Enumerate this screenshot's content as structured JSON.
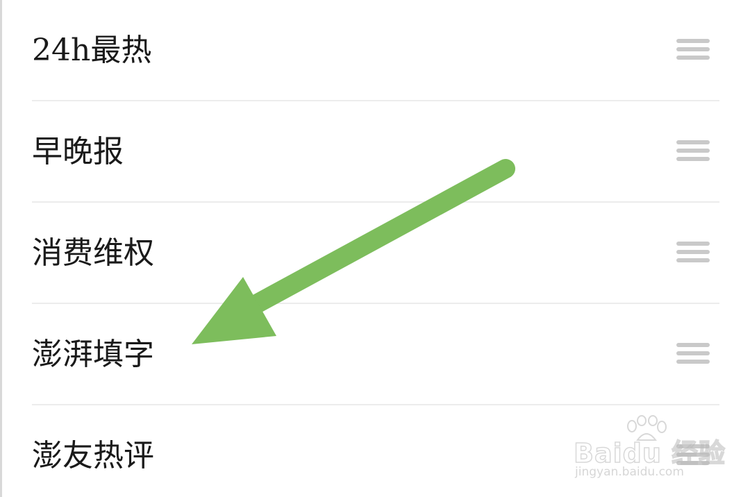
{
  "list": {
    "items": [
      {
        "label": "24h最热",
        "handle_icon": "drag-handle-icon"
      },
      {
        "label": "早晚报",
        "handle_icon": "drag-handle-icon"
      },
      {
        "label": "消费维权",
        "handle_icon": "drag-handle-icon"
      },
      {
        "label": "澎湃填字",
        "handle_icon": "drag-handle-icon"
      },
      {
        "label": "澎友热评",
        "handle_icon": "drag-handle-icon"
      }
    ]
  },
  "annotation": {
    "arrow_color": "#7dbd5c",
    "arrow_icon": "green-arrow-icon"
  },
  "watermark": {
    "brand": "Baidu 经验",
    "site": "jingyan.baidu.com",
    "icon": "paw-icon"
  },
  "colors": {
    "text": "#1a1a1a",
    "handle": "#c9c9c9",
    "divider": "#ececec",
    "background": "#ffffff"
  }
}
